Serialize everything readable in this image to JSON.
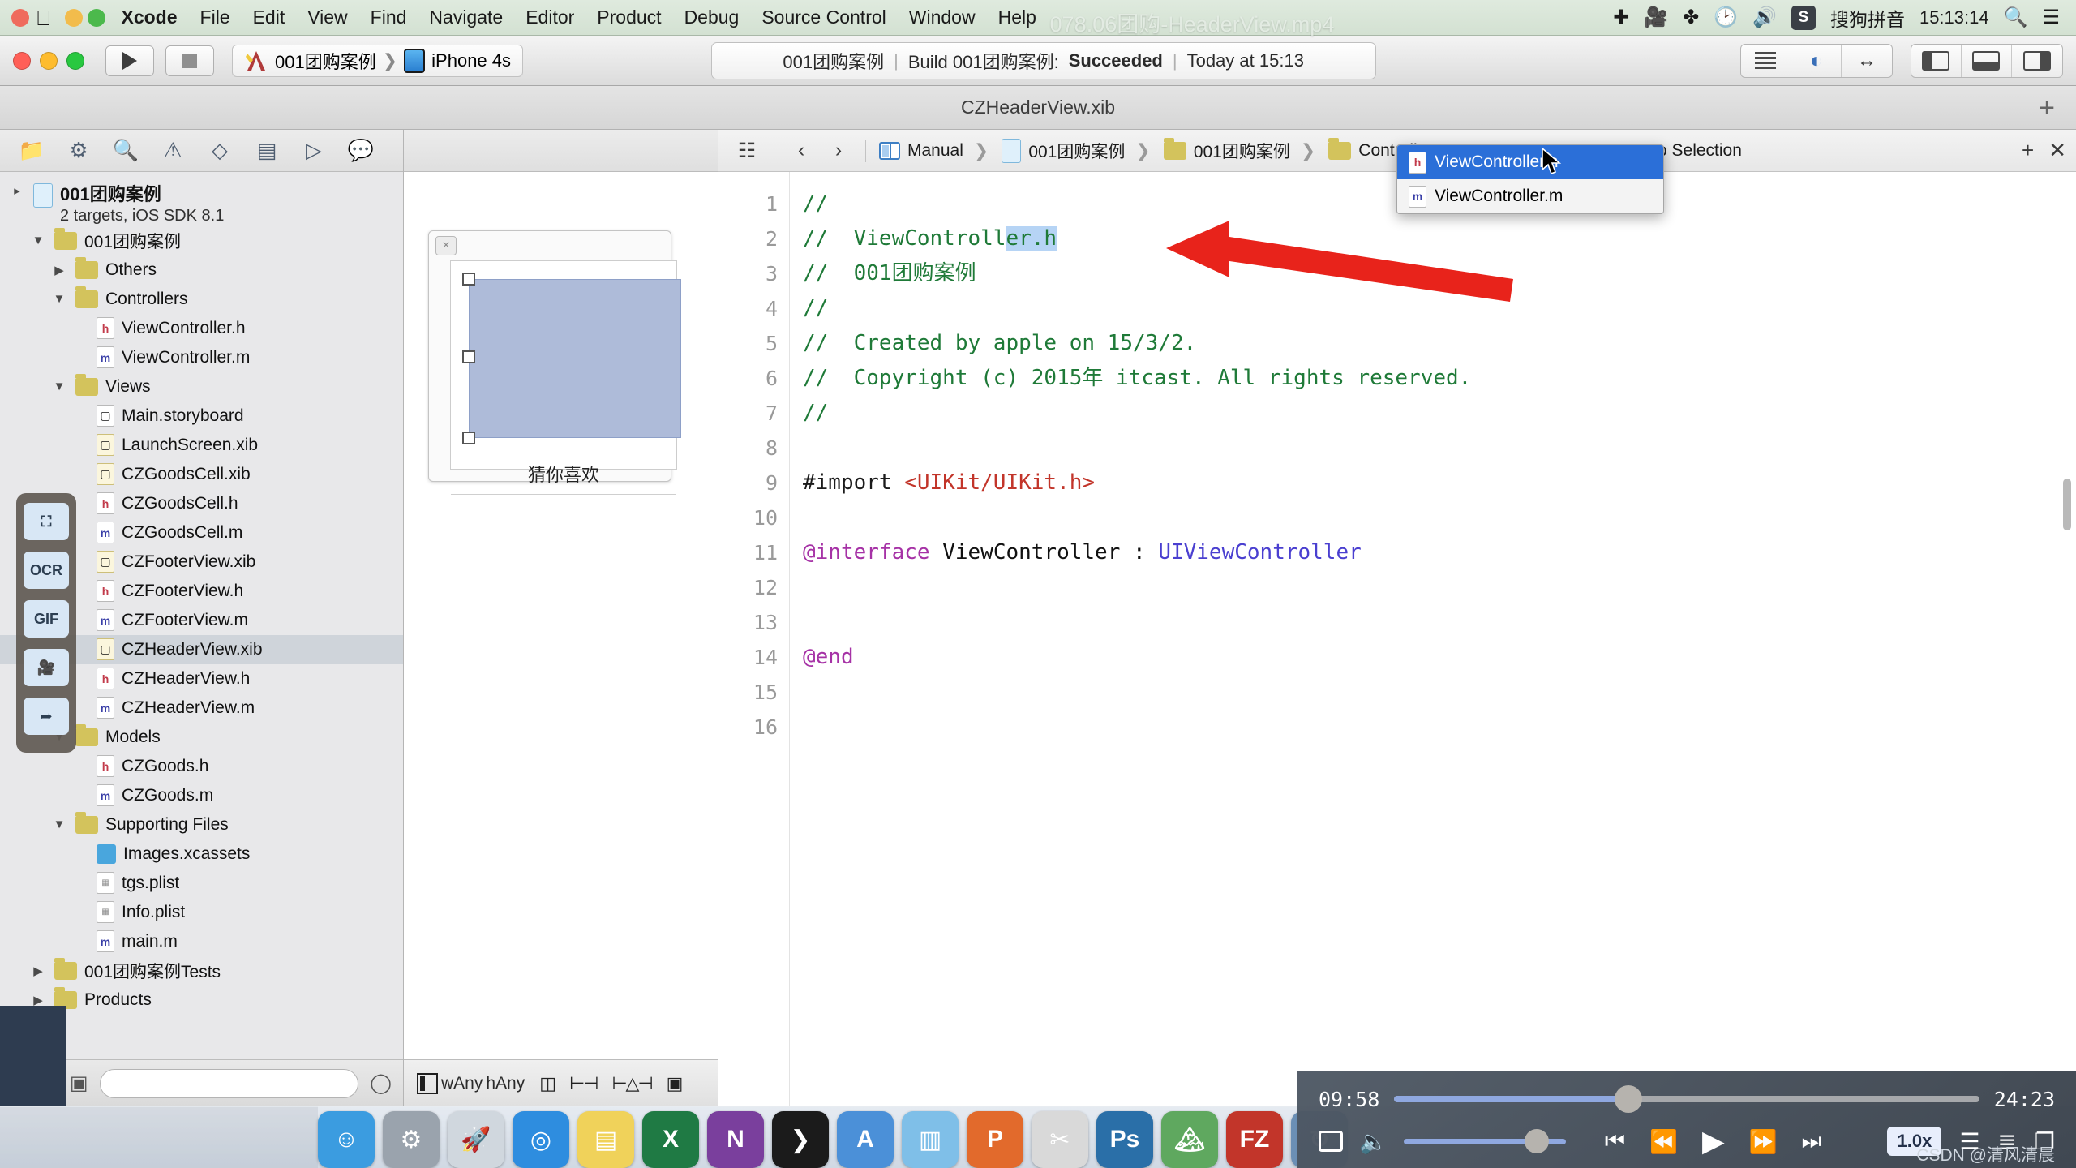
{
  "menubar": {
    "apple": "",
    "app_name": "Xcode",
    "items": [
      "File",
      "Edit",
      "View",
      "Find",
      "Navigate",
      "Editor",
      "Product",
      "Debug",
      "Source Control",
      "Window",
      "Help"
    ],
    "right_icons": [
      "airdrop-icon",
      "screen-record-icon",
      "bluetooth-icon",
      "time-machine-icon",
      "volume-icon"
    ],
    "input_badge": "S",
    "input_method": "搜狗拼音",
    "clock": "15:13:14",
    "spotlight_icon": "search-icon",
    "notification_icon": "list-icon"
  },
  "video_overlay_title": "078.06团购-HeaderView.mp4",
  "toolbar": {
    "run_label": "run-button",
    "stop_label": "stop-button",
    "scheme_project": "001团购案例",
    "scheme_device": "iPhone 4s",
    "status": {
      "project": "001团购案例",
      "build_text": "Build 001团购案例:",
      "result": "Succeeded",
      "time": "Today at 15:13"
    },
    "editor_modes": [
      "standard-editor",
      "assistant-editor",
      "version-editor"
    ],
    "view_toggles": [
      "toggle-navigator",
      "toggle-debug-area",
      "toggle-utilities"
    ]
  },
  "tabbar": {
    "title": "CZHeaderView.xib",
    "plus": "+"
  },
  "navigator": {
    "icons": [
      "folder-icon",
      "source-control-icon",
      "search-icon",
      "warning-icon",
      "breakpoint-icon",
      "report-icon",
      "test-icon",
      "debug-icon"
    ],
    "project": {
      "name": "001团购案例",
      "subtitle": "2 targets, iOS SDK 8.1"
    },
    "tree": [
      {
        "label": "001团购案例",
        "icon": "folder",
        "indent": 1,
        "twisty": "▼",
        "selected": false
      },
      {
        "label": "Others",
        "icon": "folder",
        "indent": 2,
        "twisty": "▶",
        "selected": false
      },
      {
        "label": "Controllers",
        "icon": "folder",
        "indent": 2,
        "twisty": "▼",
        "selected": false
      },
      {
        "label": "ViewController.h",
        "icon": "h",
        "indent": 3,
        "twisty": "",
        "selected": false
      },
      {
        "label": "ViewController.m",
        "icon": "m",
        "indent": 3,
        "twisty": "",
        "selected": false
      },
      {
        "label": "Views",
        "icon": "folder",
        "indent": 2,
        "twisty": "▼",
        "selected": false
      },
      {
        "label": "Main.storyboard",
        "icon": "sb",
        "indent": 3,
        "twisty": "",
        "selected": false
      },
      {
        "label": "LaunchScreen.xib",
        "icon": "xib",
        "indent": 3,
        "twisty": "",
        "selected": false
      },
      {
        "label": "CZGoodsCell.xib",
        "icon": "xib",
        "indent": 3,
        "twisty": "",
        "selected": false
      },
      {
        "label": "CZGoodsCell.h",
        "icon": "h",
        "indent": 3,
        "twisty": "",
        "selected": false
      },
      {
        "label": "CZGoodsCell.m",
        "icon": "m",
        "indent": 3,
        "twisty": "",
        "selected": false
      },
      {
        "label": "CZFooterView.xib",
        "icon": "xib",
        "indent": 3,
        "twisty": "",
        "selected": false
      },
      {
        "label": "CZFooterView.h",
        "icon": "h",
        "indent": 3,
        "twisty": "",
        "selected": false
      },
      {
        "label": "CZFooterView.m",
        "icon": "m",
        "indent": 3,
        "twisty": "",
        "selected": false
      },
      {
        "label": "CZHeaderView.xib",
        "icon": "xib",
        "indent": 3,
        "twisty": "",
        "selected": true
      },
      {
        "label": "CZHeaderView.h",
        "icon": "h",
        "indent": 3,
        "twisty": "",
        "selected": false
      },
      {
        "label": "CZHeaderView.m",
        "icon": "m",
        "indent": 3,
        "twisty": "",
        "selected": false
      },
      {
        "label": "Models",
        "icon": "folder",
        "indent": 2,
        "twisty": "▼",
        "selected": false
      },
      {
        "label": "CZGoods.h",
        "icon": "h",
        "indent": 3,
        "twisty": "",
        "selected": false
      },
      {
        "label": "CZGoods.m",
        "icon": "m",
        "indent": 3,
        "twisty": "",
        "selected": false
      },
      {
        "label": "Supporting Files",
        "icon": "folder",
        "indent": 2,
        "twisty": "▼",
        "selected": false
      },
      {
        "label": "Images.xcassets",
        "icon": "asset",
        "indent": 3,
        "twisty": "",
        "selected": false
      },
      {
        "label": "tgs.plist",
        "icon": "plist",
        "indent": 3,
        "twisty": "",
        "selected": false
      },
      {
        "label": "Info.plist",
        "icon": "plist",
        "indent": 3,
        "twisty": "",
        "selected": false
      },
      {
        "label": "main.m",
        "icon": "m",
        "indent": 3,
        "twisty": "",
        "selected": false
      },
      {
        "label": "001团购案例Tests",
        "icon": "folder",
        "indent": 1,
        "twisty": "▶",
        "selected": false
      },
      {
        "label": "Products",
        "icon": "folder",
        "indent": 1,
        "twisty": "▶",
        "selected": false
      }
    ],
    "bottom_icons": [
      "add-icon",
      "recent-icon",
      "filter-icon",
      "hide-icon"
    ],
    "filter_placeholder": ""
  },
  "toolstrip": {
    "buttons": [
      "screenshot-icon",
      "OCR",
      "GIF",
      "record-icon",
      "share-icon"
    ]
  },
  "interface_builder": {
    "close_label": "×",
    "cell_label": "猜你喜欢",
    "bottom": {
      "w_label": "wAny",
      "h_label": "hAny",
      "icons": [
        "constraints-icon",
        "align-icon",
        "pin-icon",
        "resolve-icon"
      ]
    }
  },
  "jumpbar": {
    "related_icon": "related-items-icon",
    "back": "‹",
    "forward": "›",
    "crumbs": [
      {
        "label": "Manual",
        "icon": "manual-icon"
      },
      {
        "label": "001团购案例",
        "icon": "project-icon"
      },
      {
        "label": "001团购案例",
        "icon": "folder-icon"
      },
      {
        "label": "Controllers",
        "icon": "folder-icon"
      },
      {
        "label": "ViewController.h",
        "icon": "h-file-icon"
      },
      {
        "label": "No Selection",
        "icon": ""
      }
    ],
    "right_icons": [
      "add-editor-icon",
      "close-editor-icon"
    ]
  },
  "popup": {
    "items": [
      {
        "label": "ViewController.h",
        "icon": "h",
        "active": true
      },
      {
        "label": "ViewController.m",
        "icon": "m",
        "active": false
      }
    ]
  },
  "code": {
    "line_numbers": [
      "1",
      "2",
      "3",
      "4",
      "5",
      "6",
      "7",
      "8",
      "9",
      "10",
      "11",
      "12",
      "13",
      "14",
      "15",
      "16"
    ],
    "lines": [
      "//",
      "//  ViewController.h",
      "//  001团购案例",
      "//",
      "//  Created by apple on 15/3/2.",
      "//  Copyright (c) 2015年 itcast. All rights reserved.",
      "//",
      "",
      "#import <UIKit/UIKit.h>",
      "",
      "@interface ViewController : UIViewController",
      "",
      "",
      "@end",
      "",
      ""
    ],
    "selected_text": "er.h"
  },
  "player": {
    "current_time": "09:58",
    "total_time": "24:23",
    "progress_percent": 40,
    "volume_percent": 82,
    "speed": "1.0x",
    "controls": [
      "airplay-icon",
      "volume-icon",
      "prev-icon",
      "rewind-icon",
      "play-icon",
      "forward-icon",
      "next-icon"
    ],
    "right_controls": [
      "playlist-icon",
      "settings-icon",
      "pip-icon"
    ],
    "watermark": "CSDN @清风清晨"
  },
  "dock": {
    "apps": [
      {
        "name": "finder-icon",
        "glyph": "☺",
        "color": "#3b9ce0"
      },
      {
        "name": "settings-icon",
        "glyph": "⚙",
        "color": "#9aa3ad"
      },
      {
        "name": "launchpad-icon",
        "glyph": "🚀",
        "color": "#d0d7de"
      },
      {
        "name": "safari-icon",
        "glyph": "◎",
        "color": "#2e8ddf"
      },
      {
        "name": "notes-icon",
        "glyph": "▤",
        "color": "#f0d25a"
      },
      {
        "name": "excel-icon",
        "glyph": "X",
        "color": "#1f7a44"
      },
      {
        "name": "onenote-icon",
        "glyph": "N",
        "color": "#7a3f9d"
      },
      {
        "name": "terminal-icon",
        "glyph": "❯",
        "color": "#1b1b1b"
      },
      {
        "name": "xcode-icon",
        "glyph": "A",
        "color": "#4b90d8"
      },
      {
        "name": "folder-icon",
        "glyph": "▥",
        "color": "#7fbfe8"
      },
      {
        "name": "keynote-icon",
        "glyph": "P",
        "color": "#e26a2c"
      },
      {
        "name": "snip-icon",
        "glyph": "✂",
        "color": "#d9d9d9"
      },
      {
        "name": "photoshop-icon",
        "glyph": "Ps",
        "color": "#2a6fa8"
      },
      {
        "name": "preview-icon",
        "glyph": "🏔",
        "color": "#5fa85f"
      },
      {
        "name": "filezilla-icon",
        "glyph": "FZ",
        "color": "#c2352a"
      },
      {
        "name": "cycle-icon",
        "glyph": "↻",
        "color": "#6b8fb5"
      }
    ]
  }
}
